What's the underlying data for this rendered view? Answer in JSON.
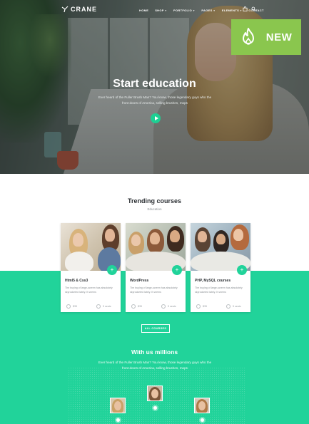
{
  "nav": {
    "logo": "CRANE",
    "menu": [
      {
        "label": "HOME",
        "caret": false
      },
      {
        "label": "SHOP",
        "caret": true
      },
      {
        "label": "PORTFOLIO",
        "caret": true
      },
      {
        "label": "PAGES",
        "caret": true
      },
      {
        "label": "ELEMENTS",
        "caret": true
      },
      {
        "label": "CONTACT",
        "caret": false
      }
    ],
    "icons": [
      "bag-icon",
      "search-icon"
    ]
  },
  "badge": {
    "label": "NEW",
    "icon": "flame-icon",
    "color": "#8ac64e"
  },
  "hero": {
    "title": "Start education",
    "text": "Ever heard of the Fuller Brush Man? You know, those legendary guys who the front doors of America, selling brushes, mops"
  },
  "trending": {
    "title": "Trending courses",
    "subtitle": "Education",
    "courses": [
      {
        "title": "Html5 & Css3",
        "desc": "The buying of large-screen has absolutely skyrocketed lately. It seems",
        "meta1": "$35",
        "meta2": "5 seats"
      },
      {
        "title": "WordPress",
        "desc": "The buying of large-screen has absolutely skyrocketed lately. It seems",
        "meta1": "$35",
        "meta2": "5 seats"
      },
      {
        "title": "PHP, MySQL courses",
        "desc": "The buying of large-screen has absolutely skyrocketed lately. It seems",
        "meta1": "$35",
        "meta2": "5 seats"
      }
    ],
    "all_button": "ALL COURSES"
  },
  "millions": {
    "title": "With us millions",
    "text": "Ever heard of the Fuller Brush Man? You know, those legendary guys who the front doors of America, selling brushes, mops"
  },
  "colors": {
    "accent": "#21d39a",
    "dark": "#2b2f33"
  }
}
